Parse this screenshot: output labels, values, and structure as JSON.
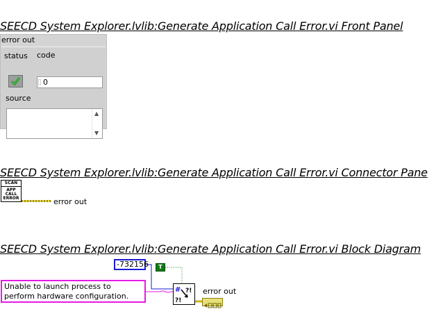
{
  "sections": {
    "front_panel_title": "SEECD System Explorer.lvlib:Generate Application Call Error.vi Front Panel",
    "connector_pane_title": "SEECD System Explorer.lvlib:Generate Application Call Error.vi Connector Pane",
    "block_diagram_title": "SEECD System Explorer.lvlib:Generate Application Call Error.vi Block Diagram"
  },
  "front_panel": {
    "cluster_label": "error out",
    "status_label": "status",
    "code_label": "code",
    "code_value": "0",
    "source_label": "source",
    "source_value": "",
    "status_icon": "check-icon"
  },
  "connector_pane": {
    "icon_lines": [
      "SCAN",
      "APP",
      "CALL",
      "ERROR"
    ],
    "terminal_label": "error out"
  },
  "block_diagram": {
    "numeric_constant": "-732156",
    "boolean_constant": "T",
    "string_constant": "Unable to launch process to perform hardware configuration.",
    "indicator_label": "error out"
  },
  "colors": {
    "error_wire": "#e8dc4a",
    "numeric_wire": "#1a1ad6",
    "string_wire": "#e61ae6",
    "boolean_wire": "#0f7a12"
  }
}
